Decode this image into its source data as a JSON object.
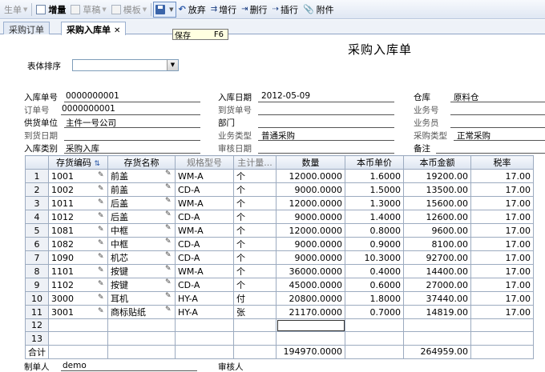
{
  "toolbar": {
    "menu_label": "生单",
    "items": [
      {
        "label": "增量",
        "icon": "new-doc-icon",
        "enabled": true
      },
      {
        "label": "草稿",
        "icon": "draft-icon",
        "enabled": false
      },
      {
        "label": "模板",
        "icon": "template-icon",
        "enabled": false
      },
      {
        "label": "放弃",
        "icon": "undo-icon",
        "enabled": true
      },
      {
        "label": "增行",
        "icon": "add-row-icon",
        "enabled": true
      },
      {
        "label": "删行",
        "icon": "delete-row-icon",
        "enabled": true
      },
      {
        "label": "插行",
        "icon": "insert-row-icon",
        "enabled": true
      },
      {
        "label": "附件",
        "icon": "attachment-icon",
        "enabled": true
      }
    ],
    "save_tooltip": {
      "label": "保存",
      "shortcut": "F6"
    }
  },
  "tabs": [
    {
      "label": "采购订单",
      "active": false
    },
    {
      "label": "采购入库单",
      "active": true
    }
  ],
  "form": {
    "title": "采购入库单",
    "sort_label": "表体排序",
    "sort_value": "",
    "fields": {
      "entry_no": {
        "label": "入库单号",
        "value": "0000000001"
      },
      "entry_date": {
        "label": "入库日期",
        "value": "2012-05-09"
      },
      "warehouse": {
        "label": "仓库",
        "value": "原料仓"
      },
      "order_no": {
        "label": "订单号",
        "value": "0000000001"
      },
      "arrival_no": {
        "label": "到货单号",
        "value": ""
      },
      "business_no": {
        "label": "业务号",
        "value": ""
      },
      "supplier": {
        "label": "供货单位",
        "value": "主件一号公司"
      },
      "department": {
        "label": "部门",
        "value": ""
      },
      "salesman": {
        "label": "业务员",
        "value": ""
      },
      "arrival_date": {
        "label": "到货日期",
        "value": ""
      },
      "business_type": {
        "label": "业务类型",
        "value": "普通采购"
      },
      "purchase_type": {
        "label": "采购类型",
        "value": "正常采购"
      },
      "entry_category": {
        "label": "入库类别",
        "value": "采购入库"
      },
      "audit_date": {
        "label": "审核日期",
        "value": ""
      },
      "remark": {
        "label": "备注",
        "value": ""
      }
    },
    "footer": {
      "maker_label": "制单人",
      "maker_value": "demo",
      "auditor_label": "审核人",
      "auditor_value": ""
    }
  },
  "grid": {
    "columns": [
      "存货编码",
      "存货名称",
      "规格型号",
      "主计量...",
      "数量",
      "本币单价",
      "本币金额",
      "税率"
    ],
    "rows": [
      {
        "n": "1",
        "code": "1001",
        "name": "前盖",
        "spec": "WM-A",
        "unit": "个",
        "qty": "12000.0000",
        "price": "1.6000",
        "amount": "19200.00",
        "tax": "17.00"
      },
      {
        "n": "2",
        "code": "1002",
        "name": "前盖",
        "spec": "CD-A",
        "unit": "个",
        "qty": "9000.0000",
        "price": "1.5000",
        "amount": "13500.00",
        "tax": "17.00"
      },
      {
        "n": "3",
        "code": "1011",
        "name": "后盖",
        "spec": "WM-A",
        "unit": "个",
        "qty": "12000.0000",
        "price": "1.3000",
        "amount": "15600.00",
        "tax": "17.00"
      },
      {
        "n": "4",
        "code": "1012",
        "name": "后盖",
        "spec": "CD-A",
        "unit": "个",
        "qty": "9000.0000",
        "price": "1.4000",
        "amount": "12600.00",
        "tax": "17.00"
      },
      {
        "n": "5",
        "code": "1081",
        "name": "中框",
        "spec": "WM-A",
        "unit": "个",
        "qty": "12000.0000",
        "price": "0.8000",
        "amount": "9600.00",
        "tax": "17.00"
      },
      {
        "n": "6",
        "code": "1082",
        "name": "中框",
        "spec": "CD-A",
        "unit": "个",
        "qty": "9000.0000",
        "price": "0.9000",
        "amount": "8100.00",
        "tax": "17.00"
      },
      {
        "n": "7",
        "code": "1090",
        "name": "机芯",
        "spec": "CD-A",
        "unit": "个",
        "qty": "9000.0000",
        "price": "10.3000",
        "amount": "92700.00",
        "tax": "17.00"
      },
      {
        "n": "8",
        "code": "1101",
        "name": "按键",
        "spec": "WM-A",
        "unit": "个",
        "qty": "36000.0000",
        "price": "0.4000",
        "amount": "14400.00",
        "tax": "17.00"
      },
      {
        "n": "9",
        "code": "1102",
        "name": "按键",
        "spec": "CD-A",
        "unit": "个",
        "qty": "45000.0000",
        "price": "0.6000",
        "amount": "27000.00",
        "tax": "17.00"
      },
      {
        "n": "10",
        "code": "3000",
        "name": "耳机",
        "spec": "HY-A",
        "unit": "付",
        "qty": "20800.0000",
        "price": "1.8000",
        "amount": "37440.00",
        "tax": "17.00"
      },
      {
        "n": "11",
        "code": "3001",
        "name": "商标贴纸",
        "spec": "HY-A",
        "unit": "张",
        "qty": "21170.0000",
        "price": "0.7000",
        "amount": "14819.00",
        "tax": "17.00"
      },
      {
        "n": "12",
        "code": "",
        "name": "",
        "spec": "",
        "unit": "",
        "qty": "",
        "price": "",
        "amount": "",
        "tax": ""
      },
      {
        "n": "13",
        "code": "",
        "name": "",
        "spec": "",
        "unit": "",
        "qty": "",
        "price": "",
        "amount": "",
        "tax": ""
      }
    ],
    "total": {
      "label": "合计",
      "qty": "194970.0000",
      "amount": "264959.00"
    }
  }
}
